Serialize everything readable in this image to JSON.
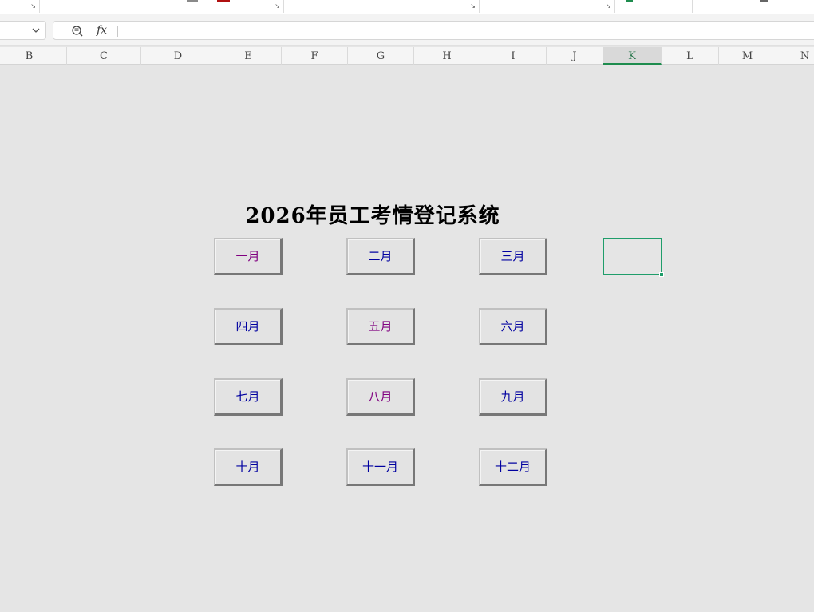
{
  "formula_bar": {
    "fx_label": "fx",
    "formula": ""
  },
  "columns": [
    "B",
    "C",
    "D",
    "E",
    "F",
    "G",
    "H",
    "I",
    "J",
    "K",
    "L",
    "M",
    "N"
  ],
  "active_column": "K",
  "sheet": {
    "title": "2026年员工考情登记系统",
    "months": [
      {
        "label": "一月",
        "color": "#800080"
      },
      {
        "label": "二月",
        "color": "#0000a0"
      },
      {
        "label": "三月",
        "color": "#0000a0"
      },
      {
        "label": "四月",
        "color": "#0000a0"
      },
      {
        "label": "五月",
        "color": "#800080"
      },
      {
        "label": "六月",
        "color": "#0000a0"
      },
      {
        "label": "七月",
        "color": "#0000a0"
      },
      {
        "label": "八月",
        "color": "#800080"
      },
      {
        "label": "九月",
        "color": "#0000a0"
      },
      {
        "label": "十月",
        "color": "#0000a0"
      },
      {
        "label": "十一月",
        "color": "#0000a0"
      },
      {
        "label": "十二月",
        "color": "#0000a0"
      }
    ]
  },
  "colors": {
    "selection": "#1f9d6a",
    "sheet_background": "#e5e5e5"
  }
}
